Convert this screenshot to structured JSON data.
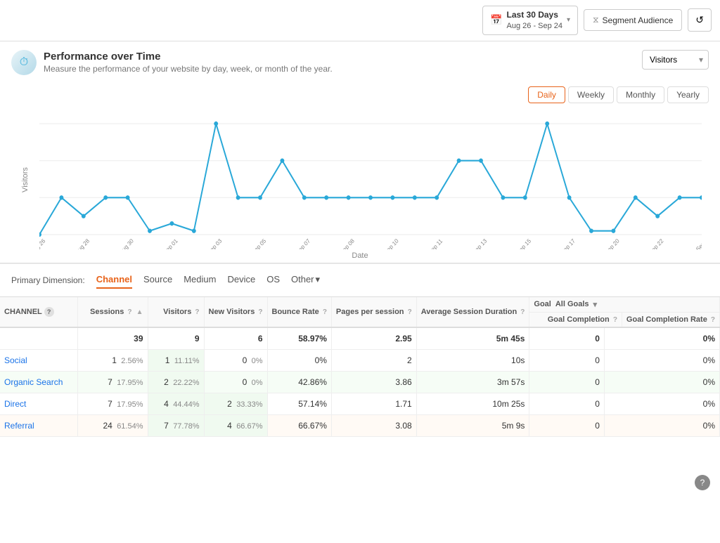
{
  "topbar": {
    "date_range_label": "Last 30 Days",
    "date_range_sub": "Aug 26 - Sep 24",
    "segment_label": "Segment Audience",
    "refresh_icon": "↺"
  },
  "performance": {
    "title": "Performance over Time",
    "subtitle": "Measure the performance of your website by day, week, or month of the year.",
    "visitors_label": "Visitors",
    "y_axis": "Visitors",
    "x_axis": "Date",
    "tabs": [
      "Daily",
      "Weekly",
      "Monthly",
      "Yearly"
    ],
    "active_tab": "Daily"
  },
  "dimensions": {
    "label": "Primary Dimension:",
    "tabs": [
      "Channel",
      "Source",
      "Medium",
      "Device",
      "OS",
      "Other"
    ]
  },
  "table": {
    "goal_label": "Goal",
    "goal_value": "All Goals",
    "columns": [
      "CHANNEL",
      "Sessions",
      "Visitors",
      "New Visitors",
      "Bounce Rate",
      "Pages per session",
      "Average Session Duration",
      "Goal Completion",
      "Goal Completion Rate"
    ],
    "total_row": {
      "channel": "",
      "sessions": "39",
      "sessions_pct": "",
      "visitors": "9",
      "visitors_pct": "",
      "new_visitors": "6",
      "new_visitors_pct": "",
      "bounce_rate": "58.97%",
      "pages_per_session": "2.95",
      "avg_session": "5m 45s",
      "goal_completion": "0",
      "goal_completion_rate": "0%"
    },
    "rows": [
      {
        "channel": "Social",
        "sessions": "1",
        "sessions_pct": "2.56%",
        "visitors": "1",
        "visitors_pct": "11.11%",
        "new_visitors": "0",
        "new_visitors_pct": "0%",
        "bounce_rate": "0%",
        "pages_per_session": "2",
        "avg_session": "10s",
        "goal_completion": "0",
        "goal_completion_rate": "0%",
        "highlight": ""
      },
      {
        "channel": "Organic Search",
        "sessions": "7",
        "sessions_pct": "17.95%",
        "visitors": "2",
        "visitors_pct": "22.22%",
        "new_visitors": "0",
        "new_visitors_pct": "0%",
        "bounce_rate": "42.86%",
        "pages_per_session": "3.86",
        "avg_session": "3m 57s",
        "goal_completion": "0",
        "goal_completion_rate": "0%",
        "highlight": "green"
      },
      {
        "channel": "Direct",
        "sessions": "7",
        "sessions_pct": "17.95%",
        "visitors": "4",
        "visitors_pct": "44.44%",
        "new_visitors": "2",
        "new_visitors_pct": "33.33%",
        "bounce_rate": "57.14%",
        "pages_per_session": "1.71",
        "avg_session": "10m 25s",
        "goal_completion": "0",
        "goal_completion_rate": "0%",
        "highlight": ""
      },
      {
        "channel": "Referral",
        "sessions": "24",
        "sessions_pct": "61.54%",
        "visitors": "7",
        "visitors_pct": "77.78%",
        "new_visitors": "4",
        "new_visitors_pct": "66.67%",
        "bounce_rate": "66.67%",
        "pages_per_session": "3.08",
        "avg_session": "5m 9s",
        "goal_completion": "0",
        "goal_completion_rate": "0%",
        "highlight": "orange"
      }
    ]
  }
}
